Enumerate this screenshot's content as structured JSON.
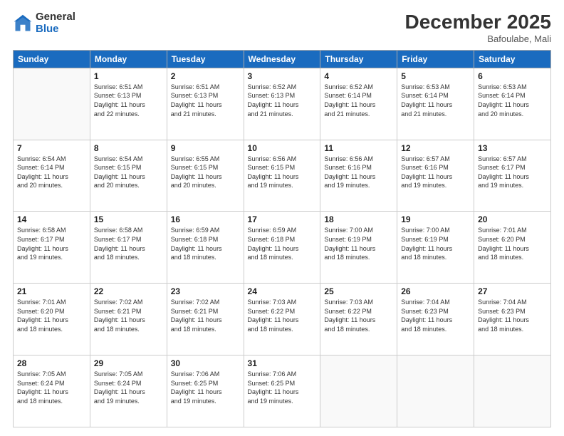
{
  "logo": {
    "general": "General",
    "blue": "Blue"
  },
  "header": {
    "month": "December 2025",
    "location": "Bafoulabe, Mali"
  },
  "days": [
    "Sunday",
    "Monday",
    "Tuesday",
    "Wednesday",
    "Thursday",
    "Friday",
    "Saturday"
  ],
  "weeks": [
    [
      {
        "day": "",
        "info": ""
      },
      {
        "day": "1",
        "info": "Sunrise: 6:51 AM\nSunset: 6:13 PM\nDaylight: 11 hours\nand 22 minutes."
      },
      {
        "day": "2",
        "info": "Sunrise: 6:51 AM\nSunset: 6:13 PM\nDaylight: 11 hours\nand 21 minutes."
      },
      {
        "day": "3",
        "info": "Sunrise: 6:52 AM\nSunset: 6:13 PM\nDaylight: 11 hours\nand 21 minutes."
      },
      {
        "day": "4",
        "info": "Sunrise: 6:52 AM\nSunset: 6:14 PM\nDaylight: 11 hours\nand 21 minutes."
      },
      {
        "day": "5",
        "info": "Sunrise: 6:53 AM\nSunset: 6:14 PM\nDaylight: 11 hours\nand 21 minutes."
      },
      {
        "day": "6",
        "info": "Sunrise: 6:53 AM\nSunset: 6:14 PM\nDaylight: 11 hours\nand 20 minutes."
      }
    ],
    [
      {
        "day": "7",
        "info": "Sunrise: 6:54 AM\nSunset: 6:14 PM\nDaylight: 11 hours\nand 20 minutes."
      },
      {
        "day": "8",
        "info": "Sunrise: 6:54 AM\nSunset: 6:15 PM\nDaylight: 11 hours\nand 20 minutes."
      },
      {
        "day": "9",
        "info": "Sunrise: 6:55 AM\nSunset: 6:15 PM\nDaylight: 11 hours\nand 20 minutes."
      },
      {
        "day": "10",
        "info": "Sunrise: 6:56 AM\nSunset: 6:15 PM\nDaylight: 11 hours\nand 19 minutes."
      },
      {
        "day": "11",
        "info": "Sunrise: 6:56 AM\nSunset: 6:16 PM\nDaylight: 11 hours\nand 19 minutes."
      },
      {
        "day": "12",
        "info": "Sunrise: 6:57 AM\nSunset: 6:16 PM\nDaylight: 11 hours\nand 19 minutes."
      },
      {
        "day": "13",
        "info": "Sunrise: 6:57 AM\nSunset: 6:17 PM\nDaylight: 11 hours\nand 19 minutes."
      }
    ],
    [
      {
        "day": "14",
        "info": "Sunrise: 6:58 AM\nSunset: 6:17 PM\nDaylight: 11 hours\nand 19 minutes."
      },
      {
        "day": "15",
        "info": "Sunrise: 6:58 AM\nSunset: 6:17 PM\nDaylight: 11 hours\nand 18 minutes."
      },
      {
        "day": "16",
        "info": "Sunrise: 6:59 AM\nSunset: 6:18 PM\nDaylight: 11 hours\nand 18 minutes."
      },
      {
        "day": "17",
        "info": "Sunrise: 6:59 AM\nSunset: 6:18 PM\nDaylight: 11 hours\nand 18 minutes."
      },
      {
        "day": "18",
        "info": "Sunrise: 7:00 AM\nSunset: 6:19 PM\nDaylight: 11 hours\nand 18 minutes."
      },
      {
        "day": "19",
        "info": "Sunrise: 7:00 AM\nSunset: 6:19 PM\nDaylight: 11 hours\nand 18 minutes."
      },
      {
        "day": "20",
        "info": "Sunrise: 7:01 AM\nSunset: 6:20 PM\nDaylight: 11 hours\nand 18 minutes."
      }
    ],
    [
      {
        "day": "21",
        "info": "Sunrise: 7:01 AM\nSunset: 6:20 PM\nDaylight: 11 hours\nand 18 minutes."
      },
      {
        "day": "22",
        "info": "Sunrise: 7:02 AM\nSunset: 6:21 PM\nDaylight: 11 hours\nand 18 minutes."
      },
      {
        "day": "23",
        "info": "Sunrise: 7:02 AM\nSunset: 6:21 PM\nDaylight: 11 hours\nand 18 minutes."
      },
      {
        "day": "24",
        "info": "Sunrise: 7:03 AM\nSunset: 6:22 PM\nDaylight: 11 hours\nand 18 minutes."
      },
      {
        "day": "25",
        "info": "Sunrise: 7:03 AM\nSunset: 6:22 PM\nDaylight: 11 hours\nand 18 minutes."
      },
      {
        "day": "26",
        "info": "Sunrise: 7:04 AM\nSunset: 6:23 PM\nDaylight: 11 hours\nand 18 minutes."
      },
      {
        "day": "27",
        "info": "Sunrise: 7:04 AM\nSunset: 6:23 PM\nDaylight: 11 hours\nand 18 minutes."
      }
    ],
    [
      {
        "day": "28",
        "info": "Sunrise: 7:05 AM\nSunset: 6:24 PM\nDaylight: 11 hours\nand 18 minutes."
      },
      {
        "day": "29",
        "info": "Sunrise: 7:05 AM\nSunset: 6:24 PM\nDaylight: 11 hours\nand 19 minutes."
      },
      {
        "day": "30",
        "info": "Sunrise: 7:06 AM\nSunset: 6:25 PM\nDaylight: 11 hours\nand 19 minutes."
      },
      {
        "day": "31",
        "info": "Sunrise: 7:06 AM\nSunset: 6:25 PM\nDaylight: 11 hours\nand 19 minutes."
      },
      {
        "day": "",
        "info": ""
      },
      {
        "day": "",
        "info": ""
      },
      {
        "day": "",
        "info": ""
      }
    ]
  ]
}
